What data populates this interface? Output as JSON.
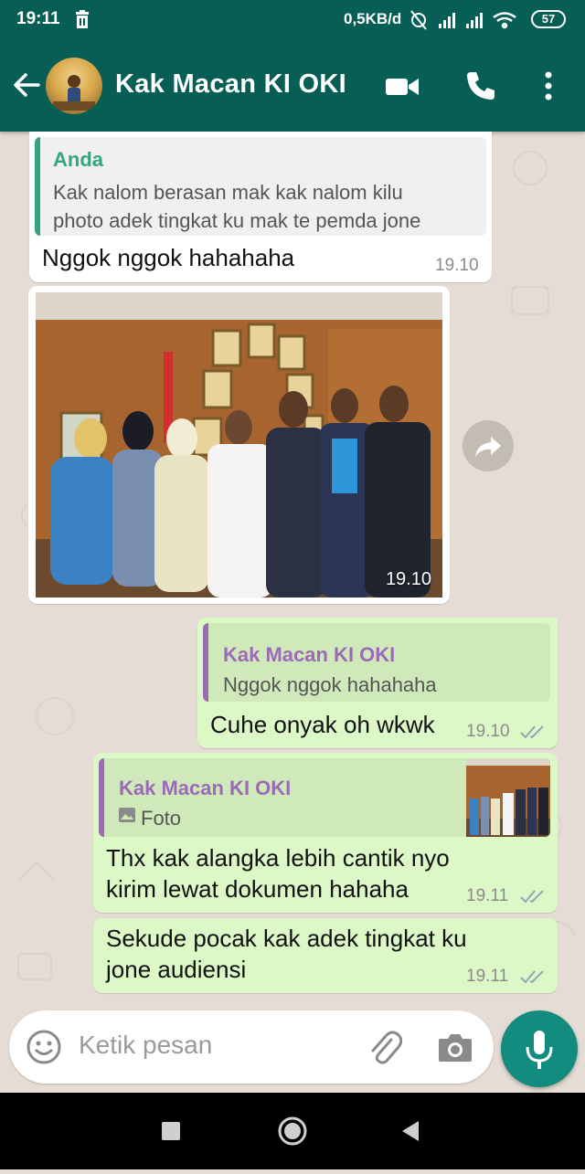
{
  "status_bar": {
    "time": "19:11",
    "network_speed": "0,5KB/d",
    "battery": "57"
  },
  "header": {
    "contact_name": "Kak Macan KI OKI",
    "icons": [
      "back-arrow-icon",
      "avatar",
      "video-call-icon",
      "phone-icon",
      "more-vert-icon"
    ]
  },
  "messages": [
    {
      "direction": "incoming",
      "quote_author": "Anda",
      "quote_text_line1": "Kak nalom berasan mak kak nalom kilu",
      "quote_text_line2": "photo adek tingkat ku mak te pemda jone",
      "text": "Nggok nggok hahahaha",
      "time": "19.10"
    },
    {
      "direction": "incoming",
      "type": "photo",
      "time": "19.10"
    },
    {
      "direction": "outgoing",
      "quote_author": "Kak Macan KI OKI",
      "quote_text": "Nggok nggok hahahaha",
      "text": "Cuhe onyak oh wkwk",
      "time": "19.10",
      "status": "read"
    },
    {
      "direction": "outgoing",
      "quote_author": "Kak Macan KI OKI",
      "quote_text": "Foto",
      "text_line1": "Thx kak alangka lebih cantik nyo",
      "text_line2": "kirim lewat dokumen hahaha",
      "time": "19.11",
      "status": "read"
    },
    {
      "direction": "outgoing",
      "text_line1": "Sekude pocak kak adek tingkat ku",
      "text_line2": "jone audiensi",
      "time": "19.11",
      "status": "read"
    }
  ],
  "composer": {
    "placeholder": "Ketik pesan"
  },
  "colors": {
    "header": "#075e54",
    "outgoing_bubble": "#dcf8c6",
    "incoming_bubble": "#ffffff",
    "chat_background": "#e5ddd5",
    "accent": "#128c7e",
    "quote_self": "#35a57d",
    "quote_contact": "#9c6bb5",
    "read_ticks": "#8fa9b3"
  }
}
